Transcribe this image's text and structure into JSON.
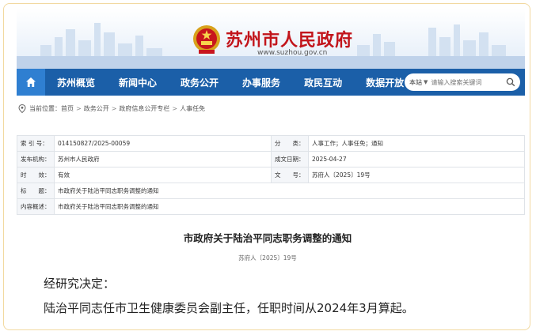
{
  "header": {
    "site_title": "苏州市人民政府",
    "site_url": "www.suzhou.gov.cn"
  },
  "nav": {
    "items": [
      {
        "label": "苏州概览"
      },
      {
        "label": "新闻中心"
      },
      {
        "label": "政务公开"
      },
      {
        "label": "办事服务"
      },
      {
        "label": "政民互动"
      },
      {
        "label": "数据开放"
      }
    ],
    "search": {
      "scope": "本站",
      "placeholder": "请输入搜索关键词"
    }
  },
  "breadcrumb": {
    "label": "当前位置：",
    "items": [
      "首页",
      "政务公开",
      "政府信息公开专栏",
      "人事任免"
    ]
  },
  "info": {
    "index_label": "索 引 号：",
    "index_value": "014150827/2025-00059",
    "category_label": "分　　类：",
    "category_value": "人事工作；人事任免；通知",
    "publisher_label": "发布机构：",
    "publisher_value": "苏州市人民政府",
    "date_label": "成文日期：",
    "date_value": "2025-04-27",
    "validity_label": "时　　效：",
    "validity_value": "有效",
    "docno_label": "文　　号：",
    "docno_value": "苏府人〔2025〕19号",
    "title_label": "标　　题：",
    "title_value": "市政府关于陆治平同志职务调整的通知",
    "summary_label": "内容概述：",
    "summary_value": "市政府关于陆治平同志职务调整的通知"
  },
  "article": {
    "title": "市政府关于陆治平同志职务调整的通知",
    "doc_no": "苏府人〔2025〕19号",
    "paragraphs": [
      "经研究决定：",
      "陆治平同志任市卫生健康委员会副主任，任职时间从2024年3月算起。"
    ]
  }
}
